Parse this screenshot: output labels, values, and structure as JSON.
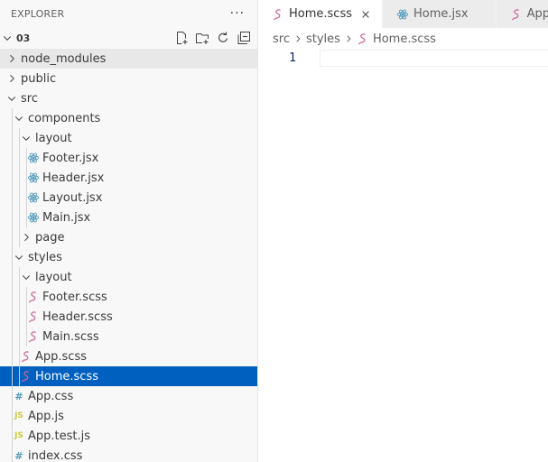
{
  "explorer": {
    "title": "EXPLORER",
    "more_label": "···",
    "root": {
      "name": "03"
    },
    "actions": [
      "new-file",
      "new-folder",
      "refresh",
      "collapse-all"
    ],
    "items": [
      {
        "label": "node_modules",
        "type": "folder",
        "expanded": false,
        "depth": 0,
        "hover": true
      },
      {
        "label": "public",
        "type": "folder",
        "expanded": false,
        "depth": 0
      },
      {
        "label": "src",
        "type": "folder",
        "expanded": true,
        "depth": 0
      },
      {
        "label": "components",
        "type": "folder",
        "expanded": true,
        "depth": 1
      },
      {
        "label": "layout",
        "type": "folder",
        "expanded": true,
        "depth": 2
      },
      {
        "label": "Footer.jsx",
        "type": "jsx",
        "depth": 3
      },
      {
        "label": "Header.jsx",
        "type": "jsx",
        "depth": 3
      },
      {
        "label": "Layout.jsx",
        "type": "jsx",
        "depth": 3
      },
      {
        "label": "Main.jsx",
        "type": "jsx",
        "depth": 3
      },
      {
        "label": "page",
        "type": "folder",
        "expanded": false,
        "depth": 2
      },
      {
        "label": "styles",
        "type": "folder",
        "expanded": true,
        "depth": 1
      },
      {
        "label": "layout",
        "type": "folder",
        "expanded": true,
        "depth": 2
      },
      {
        "label": "Footer.scss",
        "type": "scss",
        "depth": 3
      },
      {
        "label": "Header.scss",
        "type": "scss",
        "depth": 3
      },
      {
        "label": "Main.scss",
        "type": "scss",
        "depth": 3
      },
      {
        "label": "App.scss",
        "type": "scss",
        "depth": 2
      },
      {
        "label": "Home.scss",
        "type": "scss",
        "depth": 2,
        "selected": true
      },
      {
        "label": "App.css",
        "type": "css",
        "depth": 1
      },
      {
        "label": "App.js",
        "type": "js",
        "depth": 1
      },
      {
        "label": "App.test.js",
        "type": "js",
        "depth": 1
      },
      {
        "label": "index.css",
        "type": "css",
        "depth": 1
      }
    ]
  },
  "editor": {
    "tabs": [
      {
        "label": "Home.scss",
        "icon": "scss",
        "active": true,
        "close_label": "×"
      },
      {
        "label": "Home.jsx",
        "icon": "jsx",
        "active": false
      },
      {
        "label": "App.scss",
        "icon": "scss",
        "active": false
      }
    ],
    "breadcrumbs": [
      "src",
      "styles",
      "Home.scss"
    ],
    "line_numbers": [
      "1"
    ]
  },
  "colors": {
    "scss": "#cd6799",
    "jsx": "#519aba",
    "css": "#519aba",
    "js": "#cbcb41",
    "selected_bg": "#0060c0",
    "hover_bg": "#e8e8e8"
  },
  "icon_names": {
    "scss": "scss-file-icon",
    "jsx": "react-file-icon",
    "css": "css-file-icon",
    "js": "js-file-icon",
    "folder_closed": "chevron-right-icon",
    "folder_open": "chevron-down-icon"
  },
  "glyphs": {
    "css": "#",
    "js": "JS"
  }
}
